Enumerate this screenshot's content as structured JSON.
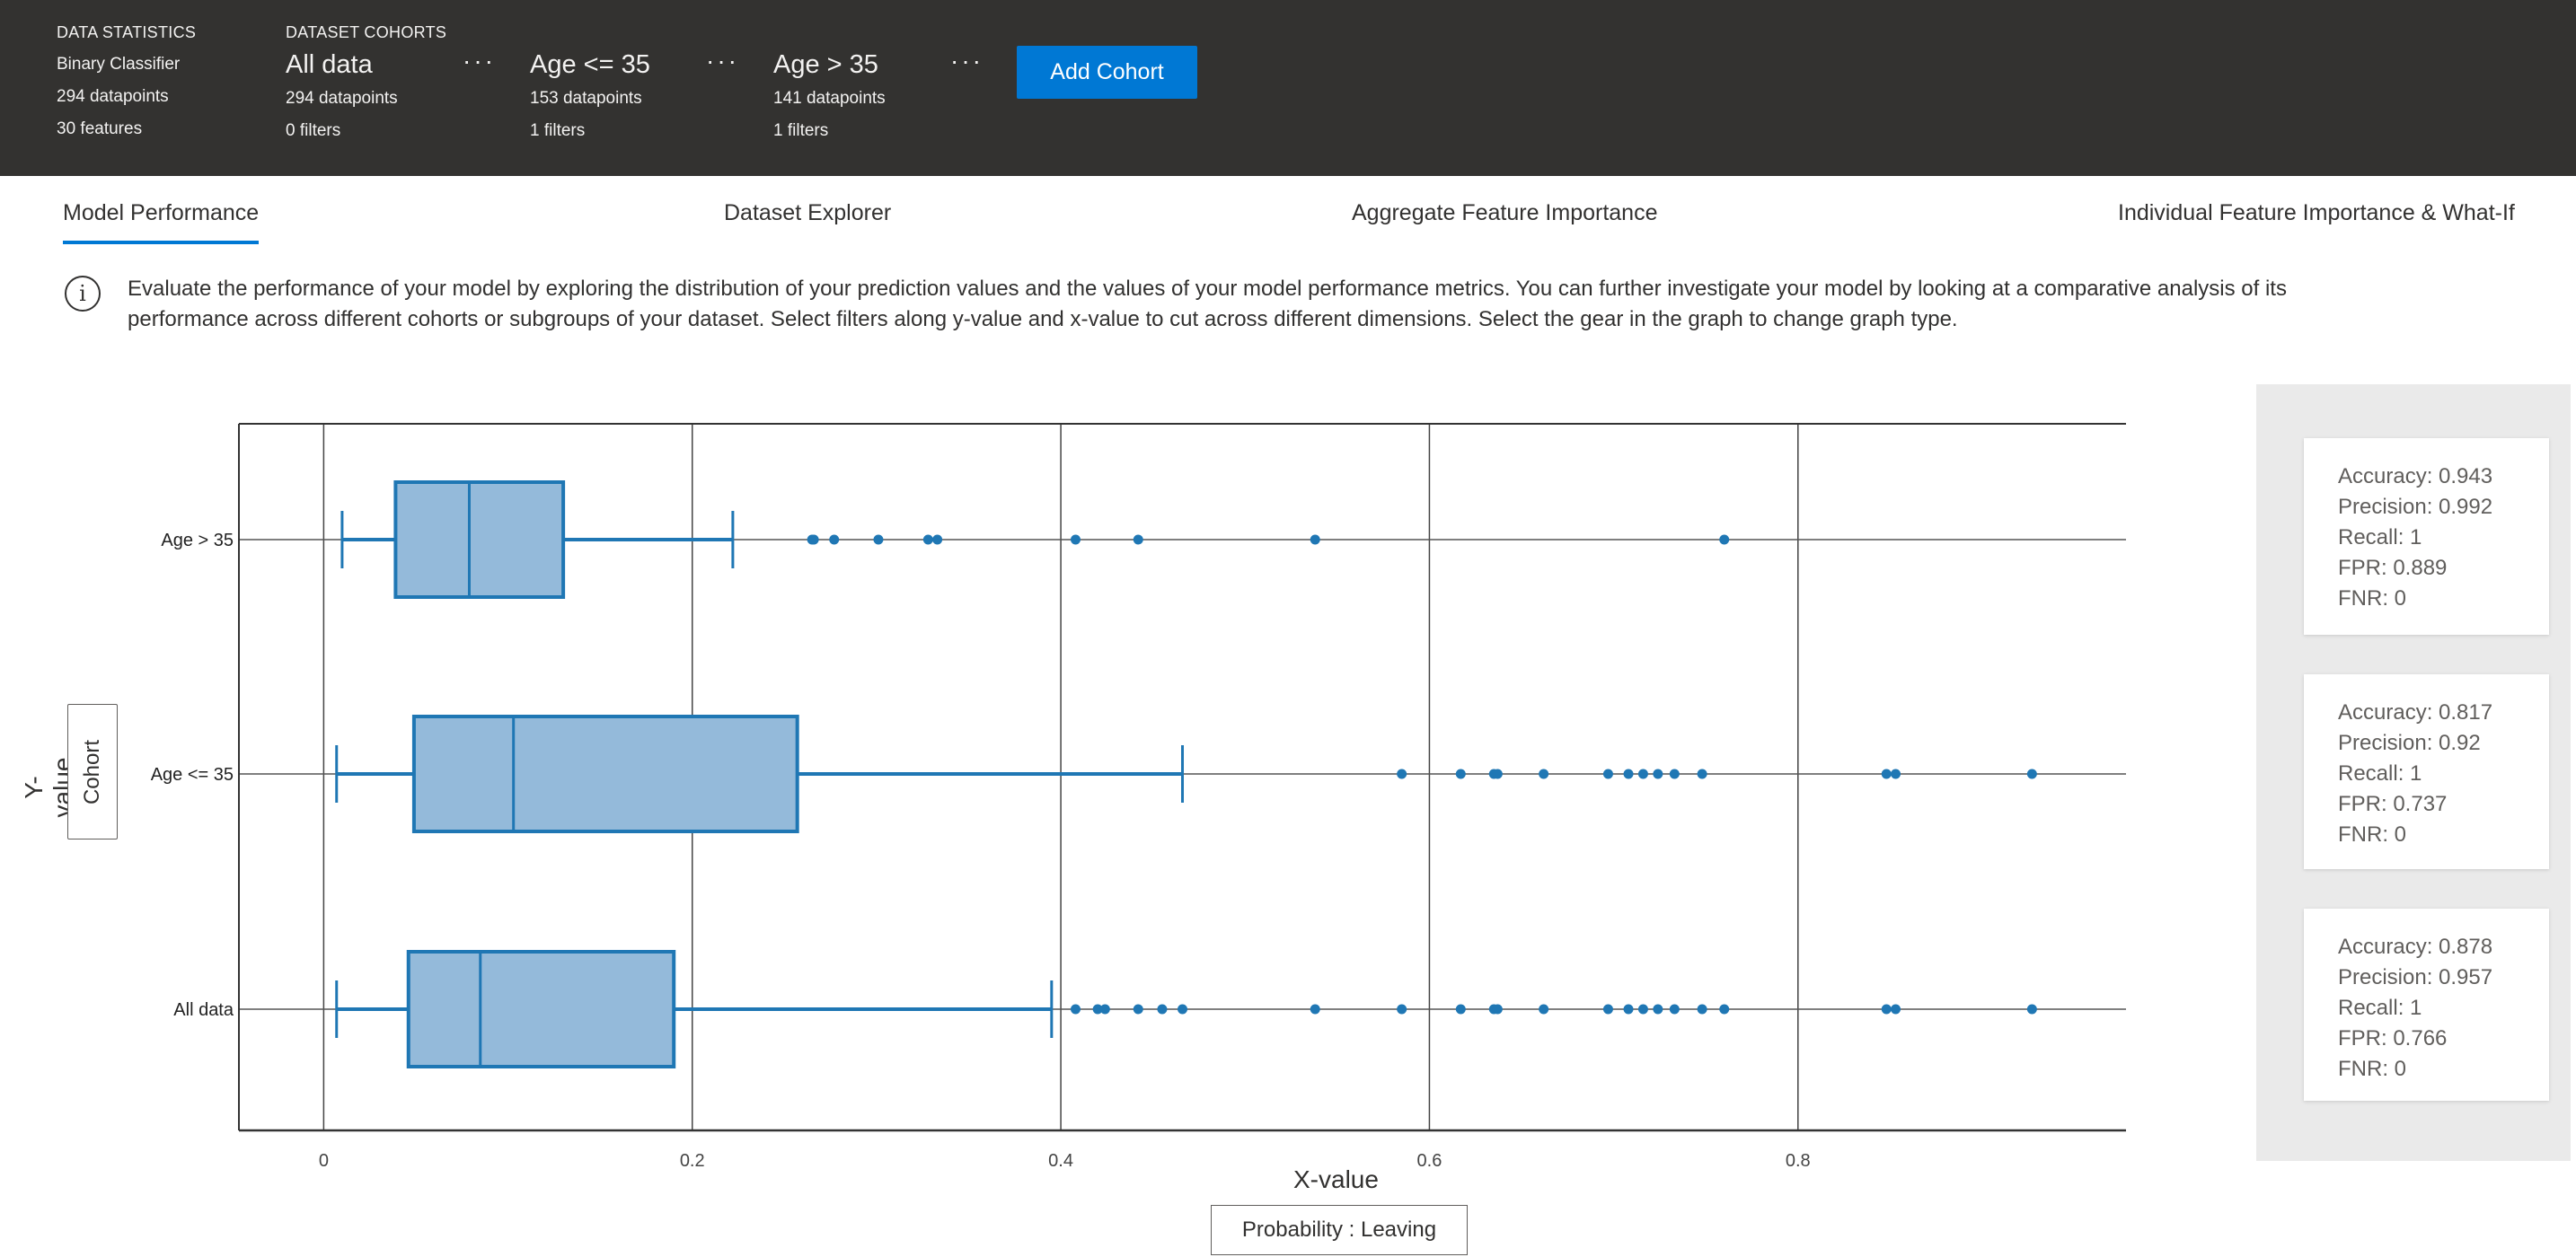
{
  "header": {
    "data_statistics": {
      "caption": "DATA STATISTICS",
      "type": "Binary Classifier",
      "datapoints": "294 datapoints",
      "features": "30 features"
    },
    "dataset_cohorts_caption": "DATASET COHORTS",
    "cohorts": [
      {
        "name": "All data",
        "datapoints": "294 datapoints",
        "filters": "0 filters",
        "menu": "···"
      },
      {
        "name": "Age <= 35",
        "datapoints": "153 datapoints",
        "filters": "1 filters",
        "menu": "···"
      },
      {
        "name": "Age > 35",
        "datapoints": "141 datapoints",
        "filters": "1 filters",
        "menu": "···"
      }
    ],
    "add_cohort": "Add Cohort"
  },
  "tabs": [
    "Model Performance",
    "Dataset Explorer",
    "Aggregate Feature Importance",
    "Individual Feature Importance & What-If"
  ],
  "active_tab": 0,
  "info": {
    "icon": "i",
    "text": "Evaluate the performance of your model by exploring the distribution of your prediction values and the values of your model performance metrics. You can further investigate your model by looking at a comparative analysis of its performance across different cohorts or subgroups of your dataset. Select filters along y-value and x-value to cut across different dimensions. Select the gear in the graph to change graph type."
  },
  "axes": {
    "y_title": "Y-value",
    "y_select": "Cohort",
    "x_title": "X-value",
    "x_select": "Probability : Leaving"
  },
  "colors": {
    "box_fill": "#94bada",
    "box_line": "#1f77b4",
    "accent": "#0078d4"
  },
  "chart_data": {
    "type": "box",
    "orientation": "horizontal",
    "xlim": [
      -0.046,
      0.978
    ],
    "xticks": [
      0,
      0.2,
      0.4,
      0.6,
      0.8
    ],
    "xtick_labels": [
      "0",
      "0.2",
      "0.4",
      "0.6",
      "0.8"
    ],
    "grid": true,
    "categories": [
      "All data",
      "Age <= 35",
      "Age > 35"
    ],
    "series": [
      {
        "name": "All data",
        "whisker_low": 0.007,
        "q1": 0.046,
        "median": 0.085,
        "q3": 0.19,
        "whisker_high": 0.395,
        "outliers": [
          0.408,
          0.42,
          0.424,
          0.442,
          0.455,
          0.466,
          0.538,
          0.585,
          0.617,
          0.635,
          0.637,
          0.662,
          0.697,
          0.708,
          0.716,
          0.724,
          0.733,
          0.748,
          0.76,
          0.848,
          0.853,
          0.927
        ]
      },
      {
        "name": "Age <= 35",
        "whisker_low": 0.007,
        "q1": 0.049,
        "median": 0.103,
        "q3": 0.257,
        "whisker_high": 0.466,
        "outliers": [
          0.585,
          0.617,
          0.635,
          0.637,
          0.662,
          0.697,
          0.708,
          0.716,
          0.724,
          0.733,
          0.748,
          0.848,
          0.853,
          0.927
        ]
      },
      {
        "name": "Age > 35",
        "whisker_low": 0.01,
        "q1": 0.039,
        "median": 0.079,
        "q3": 0.13,
        "whisker_high": 0.222,
        "outliers": [
          0.265,
          0.266,
          0.277,
          0.301,
          0.328,
          0.333,
          0.408,
          0.442,
          0.538,
          0.76
        ]
      }
    ]
  },
  "metrics": [
    {
      "cohort": "Age > 35",
      "lines": [
        "Accuracy: 0.943",
        "Precision: 0.992",
        "Recall: 1",
        "FPR: 0.889",
        "FNR: 0"
      ]
    },
    {
      "cohort": "Age <= 35",
      "lines": [
        "Accuracy: 0.817",
        "Precision: 0.92",
        "Recall: 1",
        "FPR: 0.737",
        "FNR: 0"
      ]
    },
    {
      "cohort": "All data",
      "lines": [
        "Accuracy: 0.878",
        "Precision: 0.957",
        "Recall: 1",
        "FPR: 0.766",
        "FNR: 0"
      ]
    }
  ]
}
